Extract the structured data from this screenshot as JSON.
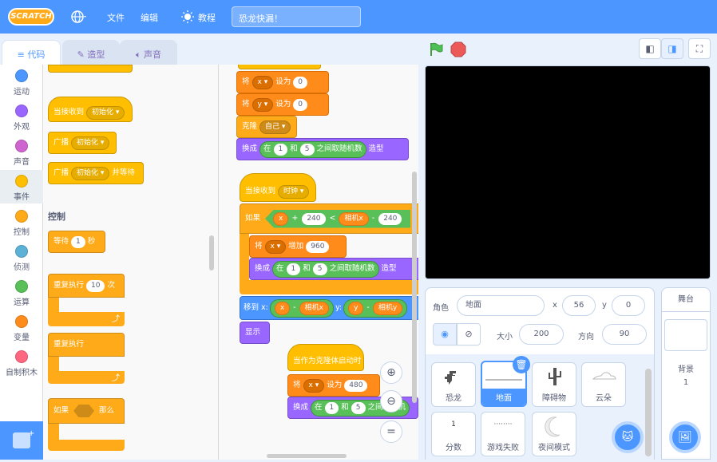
{
  "menubar": {
    "logo": "SCRATCH",
    "file": "文件",
    "edit": "编辑",
    "tutorials": "教程",
    "project_title": "恐龙快漏！"
  },
  "tabs": {
    "code": "代码",
    "costumes": "造型",
    "sounds": "声音"
  },
  "categories": [
    {
      "label": "运动",
      "color": "#4c97ff"
    },
    {
      "label": "外观",
      "color": "#9966ff"
    },
    {
      "label": "声音",
      "color": "#cf63cf"
    },
    {
      "label": "事件",
      "color": "#ffbf00"
    },
    {
      "label": "控制",
      "color": "#ffab19"
    },
    {
      "label": "侦测",
      "color": "#5cb1d6"
    },
    {
      "label": "运算",
      "color": "#59c059"
    },
    {
      "label": "变量",
      "color": "#ff8c1a"
    },
    {
      "label": "自制积木",
      "color": "#ff6680"
    }
  ],
  "palette": {
    "when_receive": "当接收到",
    "when_receive_msg": "初始化",
    "broadcast": "广播",
    "broadcast_msg": "初始化",
    "broadcast_wait": "广播",
    "broadcast_wait_msg": "初始化",
    "broadcast_wait_suffix": "并等待",
    "section_control": "控制",
    "wait": "等待",
    "wait_val": "1",
    "wait_unit": "秒",
    "repeat": "重复执行",
    "repeat_val": "10",
    "repeat_unit": "次",
    "forever": "重复执行",
    "if": "如果",
    "if_then": "那么"
  },
  "script1": {
    "set1": "将",
    "set1_var": "x",
    "set1_to": "设为",
    "set1_val": "0",
    "set2": "将",
    "set2_var": "y",
    "set2_to": "设为",
    "set2_val": "0",
    "clone": "克隆",
    "clone_target": "自己",
    "switch": "换成",
    "switch_in": "在",
    "switch_a": "1",
    "switch_and": "和",
    "switch_b": "5",
    "switch_between": "之间取随机数",
    "switch_costume": "造型"
  },
  "script2": {
    "hat": "当接收到",
    "hat_msg": "时钟",
    "if": "如果",
    "if_x": "x",
    "if_plus": "+",
    "if_240": "240",
    "if_lt": "<",
    "if_camx": "相机x",
    "if_minus": "-",
    "if_240b": "240",
    "change": "将",
    "change_var": "x",
    "change_by": "增加",
    "change_val": "960",
    "switch": "换成",
    "switch_in": "在",
    "switch_a": "1",
    "switch_and": "和",
    "switch_b": "5",
    "switch_between": "之间取随机数",
    "switch_costume": "造型",
    "goto": "移到 x:",
    "goto_x": "x",
    "goto_minus": "-",
    "goto_camx": "相机x",
    "goto_y": "y:",
    "goto_yv": "y",
    "goto_minus2": "-",
    "goto_camy": "相机y",
    "show": "显示"
  },
  "script3": {
    "hat": "当作为克隆体启动时",
    "set": "将",
    "set_var": "x",
    "set_to": "设为",
    "set_val": "480",
    "switch": "换成",
    "switch_in": "在",
    "switch_a": "1",
    "switch_and": "和",
    "switch_b": "5",
    "switch_between": "之间取随机"
  },
  "zoom": {
    "reset": "="
  },
  "sprite_info": {
    "sprite_label": "角色",
    "sprite_name": "地面",
    "x_label": "x",
    "x_val": "56",
    "y_label": "y",
    "y_val": "0",
    "size_label": "大小",
    "size_val": "200",
    "dir_label": "方向",
    "dir_val": "90"
  },
  "sprites": [
    {
      "name": "恐龙",
      "icon": "dino-icon"
    },
    {
      "name": "地面",
      "icon": "ground-icon"
    },
    {
      "name": "障碍物",
      "icon": "cactus-icon"
    },
    {
      "name": "云朵",
      "icon": "cloud-icon"
    },
    {
      "name": "分数",
      "icon": "score-icon",
      "glyph": "1"
    },
    {
      "name": "游戏失败",
      "icon": "gameover-icon",
      "glyph": "········"
    },
    {
      "name": "夜间模式",
      "icon": "moon-icon"
    }
  ],
  "stage_pane": {
    "title": "舞台",
    "backdrop_label": "背景",
    "backdrop_count": "1"
  },
  "colors": {
    "menubar": "#4c97ff",
    "accent": "#4c97ff"
  }
}
